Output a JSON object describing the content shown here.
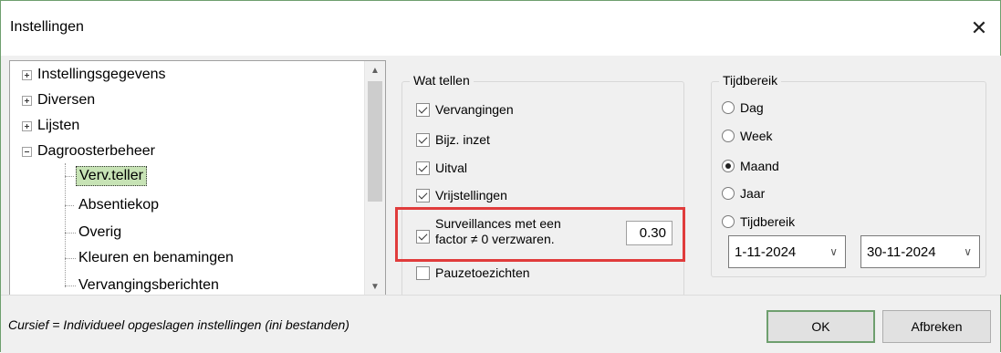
{
  "window": {
    "title": "Instellingen",
    "close_symbol": "✕"
  },
  "tree": {
    "items": [
      {
        "label": "Instellingsgegevens",
        "level": 0,
        "expander": "plus"
      },
      {
        "label": "Diversen",
        "level": 0,
        "expander": "plus"
      },
      {
        "label": "Lijsten",
        "level": 0,
        "expander": "plus"
      },
      {
        "label": "Dagroosterbeheer",
        "level": 0,
        "expander": "minus"
      },
      {
        "label": "Verv.teller",
        "level": 1,
        "selected": true
      },
      {
        "label": "Absentiekop",
        "level": 1
      },
      {
        "label": "Overig",
        "level": 1
      },
      {
        "label": "Kleuren en benamingen",
        "level": 1
      },
      {
        "label": "Vervangingsberichten",
        "level": 1
      }
    ],
    "scroll_up": "▲",
    "scroll_down": "▼"
  },
  "wat_tellen": {
    "legend": "Wat tellen",
    "vervangingen": "Vervangingen",
    "bijz_inzet": "Bijz. inzet",
    "uitval": "Uitval",
    "vrijstellingen": "Vrijstellingen",
    "surveillances_line1": "Surveillances met een",
    "surveillances_line2": "factor ≠ 0 verzwaren.",
    "factor_value": "0.30",
    "pauzetoezichten": "Pauzetoezichten"
  },
  "tijdbereik": {
    "legend": "Tijdbereik",
    "options": [
      "Dag",
      "Week",
      "Maand",
      "Jaar",
      "Tijdbereik"
    ],
    "selected": "Maand",
    "from_date": "1-11-2024",
    "to_date": "30-11-2024",
    "chevron": "∨"
  },
  "footer": {
    "note": "Cursief = Individueel opgeslagen instellingen (ini bestanden)",
    "ok_label": "OK",
    "cancel_label": "Afbreken"
  },
  "colors": {
    "selection_bg": "#c7e3b5",
    "highlight_border": "#e03c3c",
    "frame_border": "#6e9f6e"
  }
}
